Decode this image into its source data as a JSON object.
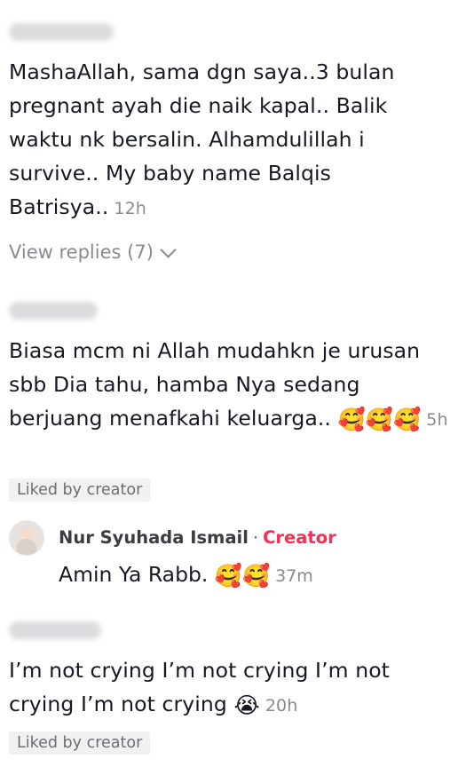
{
  "comments": [
    {
      "text": "MashaAllah, sama dgn saya..3 bulan pregnant ayah die naik kapal.. Balik waktu nk bersalin. Alhamdulillah i survive.. My baby name Balqis Batrisya..",
      "time": "12h",
      "view_replies_label": "View replies (7)"
    },
    {
      "text": "Biasa mcm ni Allah mudahkn je urusan sbb Dia tahu, hamba Nya sedang berjuang menafkahi keluarga..",
      "emoji": "🥰🥰🥰",
      "time": "5h",
      "badge": "Liked by creator"
    },
    {
      "text": "I’m not crying I’m not crying I’m not crying I’m not crying",
      "emoji": "😭",
      "time": "20h",
      "badge": "Liked by creator"
    }
  ],
  "reply": {
    "username": "Nur Syuhada Ismail",
    "separator": "·",
    "creator_label": "Creator",
    "text": "Amin Ya Rabb.",
    "emoji": "🥰🥰",
    "time": "37m"
  },
  "colors": {
    "text": "#161823",
    "muted": "#8a8b91",
    "creator_accent": "#fe2c55",
    "badge_bg": "#f1f1f2"
  },
  "icons": {
    "expand": "chevron-down-icon"
  }
}
